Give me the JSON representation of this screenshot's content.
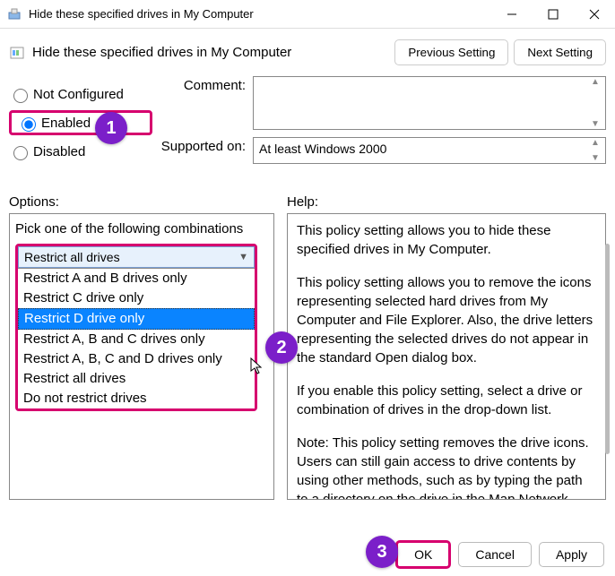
{
  "window": {
    "title": "Hide these specified drives in My Computer"
  },
  "header": {
    "title": "Hide these specified drives in My Computer",
    "prev_btn": "Previous Setting",
    "next_btn": "Next Setting"
  },
  "config_radios": {
    "not_configured": "Not Configured",
    "enabled": "Enabled",
    "disabled": "Disabled",
    "selected": "enabled"
  },
  "fields": {
    "comment_label": "Comment:",
    "comment_value": "",
    "supported_label": "Supported on:",
    "supported_value": "At least Windows 2000"
  },
  "sections": {
    "options_label": "Options:",
    "help_label": "Help:"
  },
  "options": {
    "prompt": "Pick one of the following combinations",
    "selected": "Restrict all drives",
    "items": [
      "Restrict A and B drives only",
      "Restrict C drive only",
      "Restrict D drive only",
      "Restrict A, B and C drives only",
      "Restrict A, B, C and D drives only",
      "Restrict all drives",
      "Do not restrict drives"
    ],
    "highlighted_index": 2
  },
  "help": {
    "p1": "This policy setting allows you to hide these specified drives in My Computer.",
    "p2": "This policy setting allows you to remove the icons representing selected hard drives from My Computer and File Explorer. Also, the drive letters representing the selected drives do not appear in the standard Open dialog box.",
    "p3": "If you enable this policy setting, select a drive or combination of drives in the drop-down list.",
    "p4": "Note: This policy setting removes the drive icons. Users can still gain access to drive contents by using other methods, such as by typing the path to a directory on the drive in the Map Network Drive"
  },
  "footer": {
    "ok": "OK",
    "cancel": "Cancel",
    "apply": "Apply"
  },
  "badges": {
    "b1": "1",
    "b2": "2",
    "b3": "3"
  }
}
